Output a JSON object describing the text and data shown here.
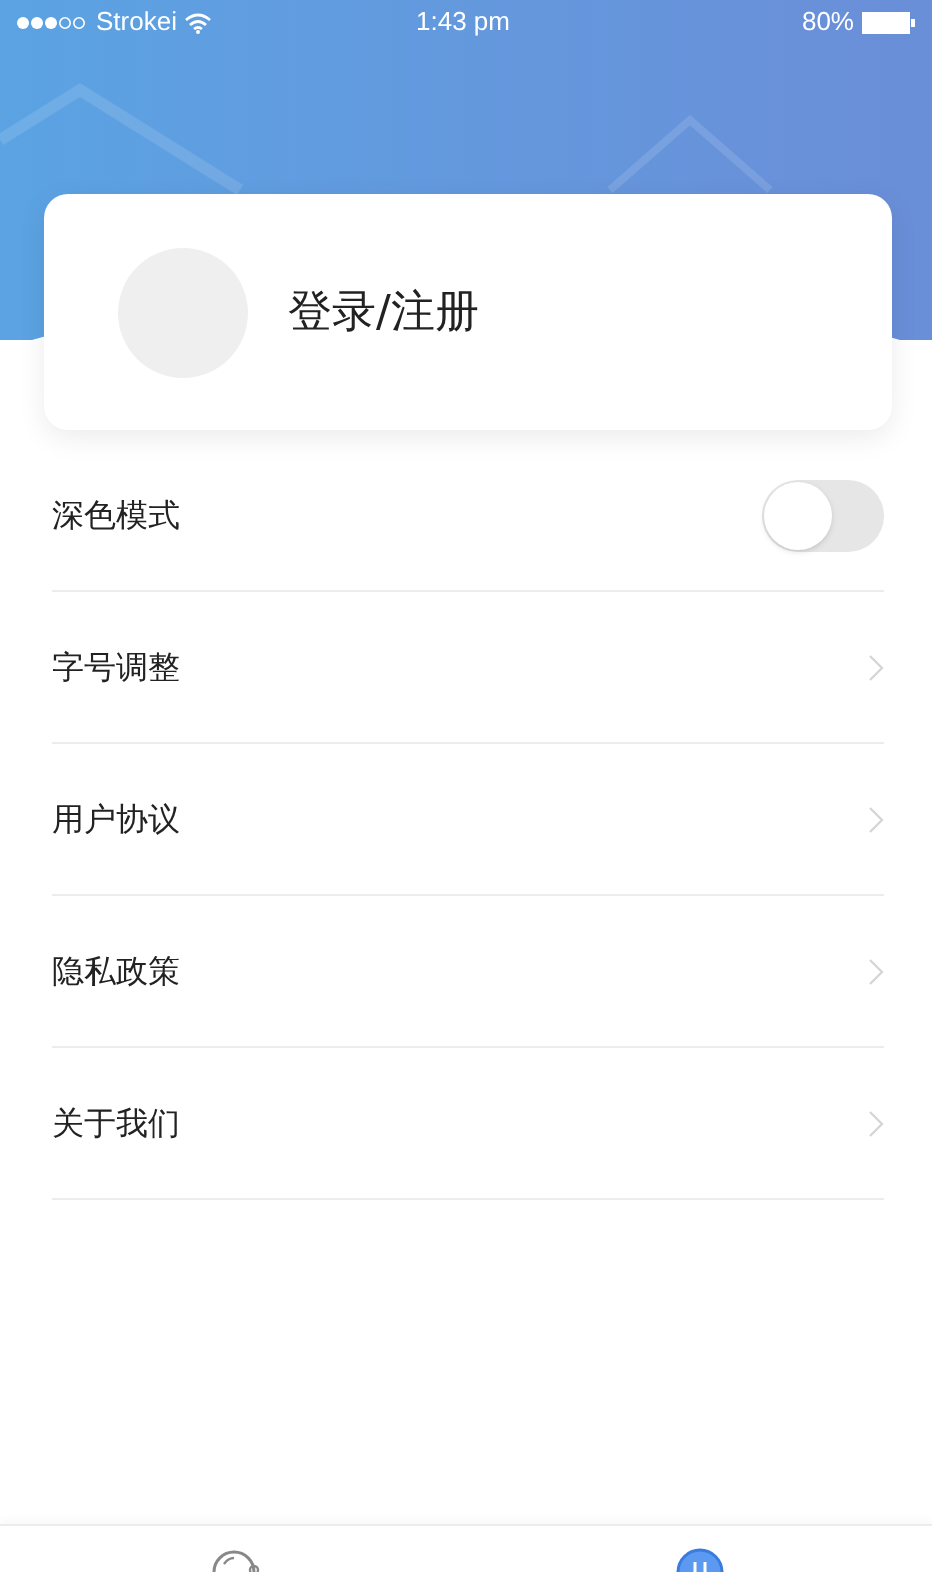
{
  "status_bar": {
    "carrier": "Strokei",
    "time": "1:43 pm",
    "battery": "80%"
  },
  "profile": {
    "login_label": "登录/注册"
  },
  "settings": [
    {
      "kind": "toggle",
      "label": "深色模式",
      "on": false
    },
    {
      "kind": "link",
      "label": "字号调整"
    },
    {
      "kind": "link",
      "label": "用户协议"
    },
    {
      "kind": "link",
      "label": "隐私政策"
    },
    {
      "kind": "link",
      "label": "关于我们"
    }
  ],
  "tab_bar": [
    {
      "selected": false
    },
    {
      "selected": true
    }
  ]
}
